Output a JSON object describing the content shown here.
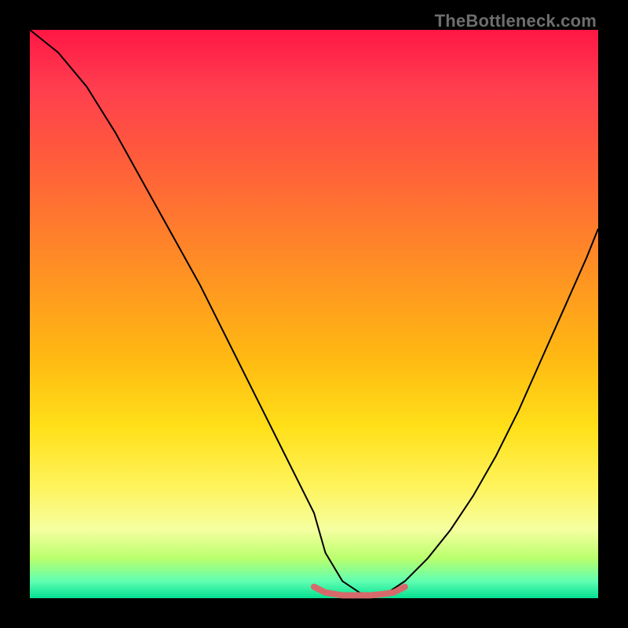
{
  "watermark": {
    "text": "TheBottleneck.com"
  },
  "colors": {
    "background": "#000000",
    "curve": "#000000",
    "band": "#d66a6a",
    "gradient_stops": [
      "#ff1744",
      "#ff3d4f",
      "#ff5a3c",
      "#ff7a2e",
      "#ff9a1f",
      "#ffba12",
      "#ffe019",
      "#fff35a",
      "#f5ffa0",
      "#b8ff6a",
      "#5effb0",
      "#00e090"
    ]
  },
  "chart_data": {
    "type": "line",
    "title": "",
    "xlabel": "",
    "ylabel": "",
    "xlim": [
      0,
      100
    ],
    "ylim": [
      0,
      100
    ],
    "grid": false,
    "legend": false,
    "series": [
      {
        "name": "left-curve",
        "x": [
          0,
          5,
          10,
          15,
          20,
          25,
          30,
          35,
          40,
          45,
          50,
          52,
          55,
          58,
          60
        ],
        "y": [
          100,
          96,
          90,
          82,
          73,
          64,
          55,
          45,
          35,
          25,
          15,
          8,
          3,
          1,
          0
        ]
      },
      {
        "name": "right-curve",
        "x": [
          60,
          63,
          66,
          70,
          74,
          78,
          82,
          86,
          90,
          94,
          98,
          100
        ],
        "y": [
          0,
          1,
          3,
          7,
          12,
          18,
          25,
          33,
          42,
          51,
          60,
          65
        ]
      },
      {
        "name": "bottom-band",
        "x": [
          50,
          52,
          55,
          58,
          60,
          62,
          64,
          66
        ],
        "y": [
          2,
          1,
          0.5,
          0.5,
          0.5,
          0.7,
          1,
          2
        ]
      }
    ],
    "annotations": []
  }
}
